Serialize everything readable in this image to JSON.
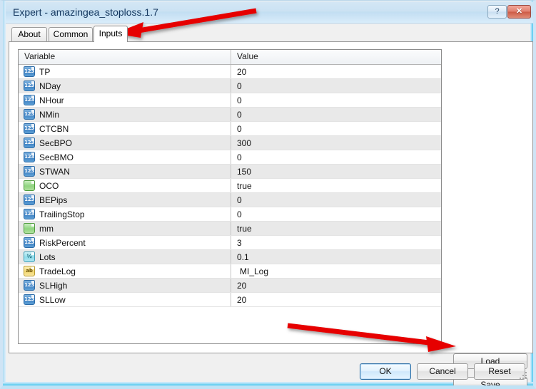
{
  "window": {
    "title": "Expert - amazingea_stoploss.1.7",
    "help_label": "?",
    "close_label": "✕"
  },
  "tabs": [
    {
      "label": "About",
      "active": false
    },
    {
      "label": "Common",
      "active": false
    },
    {
      "label": "Inputs",
      "active": true
    }
  ],
  "grid": {
    "columns": [
      "Variable",
      "Value"
    ],
    "rows": [
      {
        "icon": "int-type-icon",
        "glyph": "123",
        "variable": "TP",
        "value": "20"
      },
      {
        "icon": "int-type-icon",
        "glyph": "123",
        "variable": "NDay",
        "value": "0"
      },
      {
        "icon": "int-type-icon",
        "glyph": "123",
        "variable": "NHour",
        "value": "0"
      },
      {
        "icon": "int-type-icon",
        "glyph": "123",
        "variable": "NMin",
        "value": "0"
      },
      {
        "icon": "int-type-icon",
        "glyph": "123",
        "variable": "CTCBN",
        "value": "0"
      },
      {
        "icon": "int-type-icon",
        "glyph": "123",
        "variable": "SecBPO",
        "value": "300"
      },
      {
        "icon": "int-type-icon",
        "glyph": "123",
        "variable": "SecBMO",
        "value": "0"
      },
      {
        "icon": "int-type-icon",
        "glyph": "123",
        "variable": "STWAN",
        "value": "150"
      },
      {
        "icon": "bool-type-icon",
        "glyph": "",
        "variable": "OCO",
        "value": "true"
      },
      {
        "icon": "int-type-icon",
        "glyph": "123",
        "variable": "BEPips",
        "value": "0"
      },
      {
        "icon": "int-type-icon",
        "glyph": "123",
        "variable": "TrailingStop",
        "value": "0"
      },
      {
        "icon": "bool-type-icon",
        "glyph": "",
        "variable": "mm",
        "value": "true"
      },
      {
        "icon": "int-type-icon",
        "glyph": "123",
        "variable": "RiskPercent",
        "value": "3"
      },
      {
        "icon": "double-type-icon",
        "glyph": "½",
        "variable": "Lots",
        "value": "0.1"
      },
      {
        "icon": "string-type-icon",
        "glyph": "ab",
        "variable": "TradeLog",
        "value": "MI_Log",
        "editing": true
      },
      {
        "icon": "int-type-icon",
        "glyph": "123",
        "variable": "SLHigh",
        "value": "20"
      },
      {
        "icon": "int-type-icon",
        "glyph": "123",
        "variable": "SLLow",
        "value": "20"
      }
    ]
  },
  "side_buttons": {
    "load": "Load",
    "save": "Save"
  },
  "footer_buttons": {
    "ok": "OK",
    "cancel": "Cancel",
    "reset": "Reset"
  },
  "annotations": {
    "arrow_color": "#e60000",
    "arrow_to_inputs_tab": "points to Inputs tab",
    "arrow_to_save_button": "points to Save button"
  }
}
